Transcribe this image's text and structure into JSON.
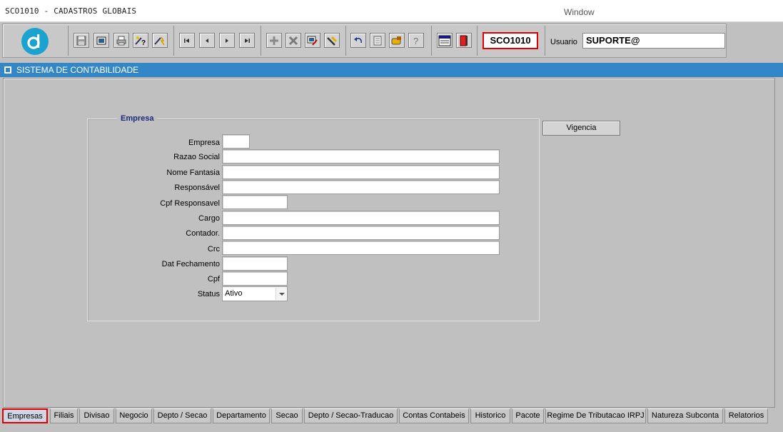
{
  "window": {
    "title": "SCO1010 - CADASTROS GLOBAIS",
    "menu": "Window"
  },
  "toolbar": {
    "program_code": "SCO1010",
    "user_label": "Usuario",
    "user_value": "SUPORTE@",
    "buttons": [
      "save-icon",
      "form-icon",
      "print-icon",
      "query-enter-icon",
      "query-execute-icon",
      "first-record-icon",
      "previous-record-icon",
      "next-record-icon",
      "last-record-icon",
      "insert-record-icon",
      "delete-record-icon",
      "edit-record-icon",
      "clear-record-icon",
      "undo-icon",
      "list-icon",
      "hand-icon",
      "help-icon",
      "menu-icon",
      "exit-icon"
    ]
  },
  "app": {
    "system_title": "SISTEMA DE CONTABILIDADE"
  },
  "form": {
    "frame_title": "Empresa",
    "vigencia_button": "Vigencia",
    "fields": {
      "empresa": {
        "label": "Empresa",
        "value": ""
      },
      "razao_social": {
        "label": "Razao Social",
        "value": ""
      },
      "nome_fantasia": {
        "label": "Nome Fantasia",
        "value": ""
      },
      "responsavel": {
        "label": "Responsável",
        "value": ""
      },
      "cpf_responsavel": {
        "label": "Cpf Responsavel",
        "value": ""
      },
      "cargo": {
        "label": "Cargo",
        "value": ""
      },
      "contador": {
        "label": "Contador.",
        "value": ""
      },
      "crc": {
        "label": "Crc",
        "value": ""
      },
      "dat_fechamento": {
        "label": "Dat Fechamento",
        "value": ""
      },
      "cpf": {
        "label": "Cpf",
        "value": ""
      },
      "status": {
        "label": "Status",
        "value": "Ativo"
      }
    }
  },
  "tabs": [
    "Empresas",
    "Filiais",
    "Divisao",
    "Negocio",
    "Depto / Secao",
    "Departamento",
    "Secao",
    "Depto / Secao-Traducao",
    "Contas Contabeis",
    "Historico",
    "Pacote",
    "Regime De Tributacao IRPJ",
    "Natureza Subconta",
    "Relatorios"
  ],
  "active_tab": "Empresas"
}
